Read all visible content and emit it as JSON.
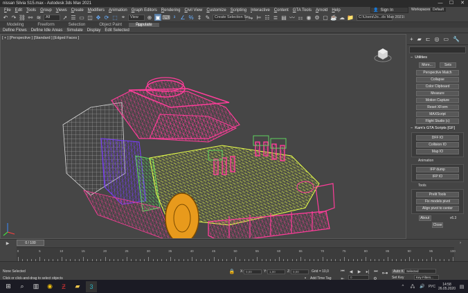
{
  "window": {
    "title": "nissan Silvia S15.max - Autodesk 3ds Max 2021"
  },
  "menubar": {
    "items": [
      "File",
      "Edit",
      "Tools",
      "Group",
      "Views",
      "Create",
      "Modifiers",
      "Animation",
      "Graph Editors",
      "Rendering",
      "Civil View",
      "Customize",
      "Scripting",
      "Interactive",
      "Content",
      "GTA Tools",
      "Arnold",
      "Help"
    ],
    "sign_in": "Sign In",
    "workspaces_label": "Workspaces:",
    "workspace_value": "Default"
  },
  "toolbar": {
    "filter_value": "All",
    "view_value": "View",
    "selection_set_placeholder": "Create Selection Se",
    "path_value": "C:\\Users\\Jo...ds Max 2021\\"
  },
  "ribbon": {
    "tabs": [
      "Modeling",
      "Freeform",
      "Selection",
      "Object Paint",
      "Populate"
    ],
    "sub_items": [
      "Define Flows",
      "Define Idle Areas",
      "Simulate",
      "Display",
      "Edit Selected"
    ]
  },
  "viewport": {
    "label": "[ + ] [Perspective ] [Standard ] [Edged Faces ]"
  },
  "command_panel": {
    "utilities_title": "Utilities",
    "more_button": "More...",
    "sets_button": "Sets",
    "buttons": [
      "Perspective Match",
      "Collapse",
      "Color Clipboard",
      "Measure",
      "Motion Capture",
      "Reset XForm",
      "MAXScript",
      "Flight Studio (c)"
    ],
    "gta_title": "Kam's GTA Scripts [GF]",
    "gta_buttons": [
      "DFF IO",
      "Collision IO",
      "Map IO"
    ],
    "animation_label": "Animation",
    "animation_buttons": [
      "IFP dump",
      "IFP IO"
    ],
    "tools_label": "Tools",
    "tools_buttons": [
      "Prelit Tools",
      "Fix models pivot",
      "Align pivot to center"
    ],
    "about_button": "About",
    "version": "v6.3",
    "close_button": "Close"
  },
  "timeline": {
    "frame_display": "0 / 100",
    "ticks": [
      "0",
      "5",
      "10",
      "15",
      "20",
      "25",
      "30",
      "35",
      "40",
      "45",
      "50",
      "55",
      "60",
      "65",
      "70",
      "75",
      "80",
      "85",
      "90",
      "95",
      "100"
    ]
  },
  "status": {
    "selection": "None Selected",
    "prompt": "Click or click-and-drag to select objects",
    "x_label": "X:",
    "x_value": "0,00",
    "y_label": "Y:",
    "y_value": "1,00",
    "z_label": "Z:",
    "z_value": "0,00",
    "grid": "Grid = 10,0",
    "add_time_tag": "Add Time Tag",
    "frame_value": "0",
    "auto_key": "Auto K",
    "set_key": "Set Key",
    "selected_value": "Selected",
    "key_filters": "Key Filters..."
  },
  "taskbar": {
    "time": "14:58",
    "date": "26.05.2020",
    "lang": "РУС"
  },
  "colors": {
    "wire_pink": "#ff3d9a",
    "wire_yellow": "#e8ff4a",
    "wire_green": "#60e060",
    "wire_purple": "#7a3cff",
    "wheel_orange": "#e89a1c",
    "accent_blue": "#5a7fa8"
  }
}
